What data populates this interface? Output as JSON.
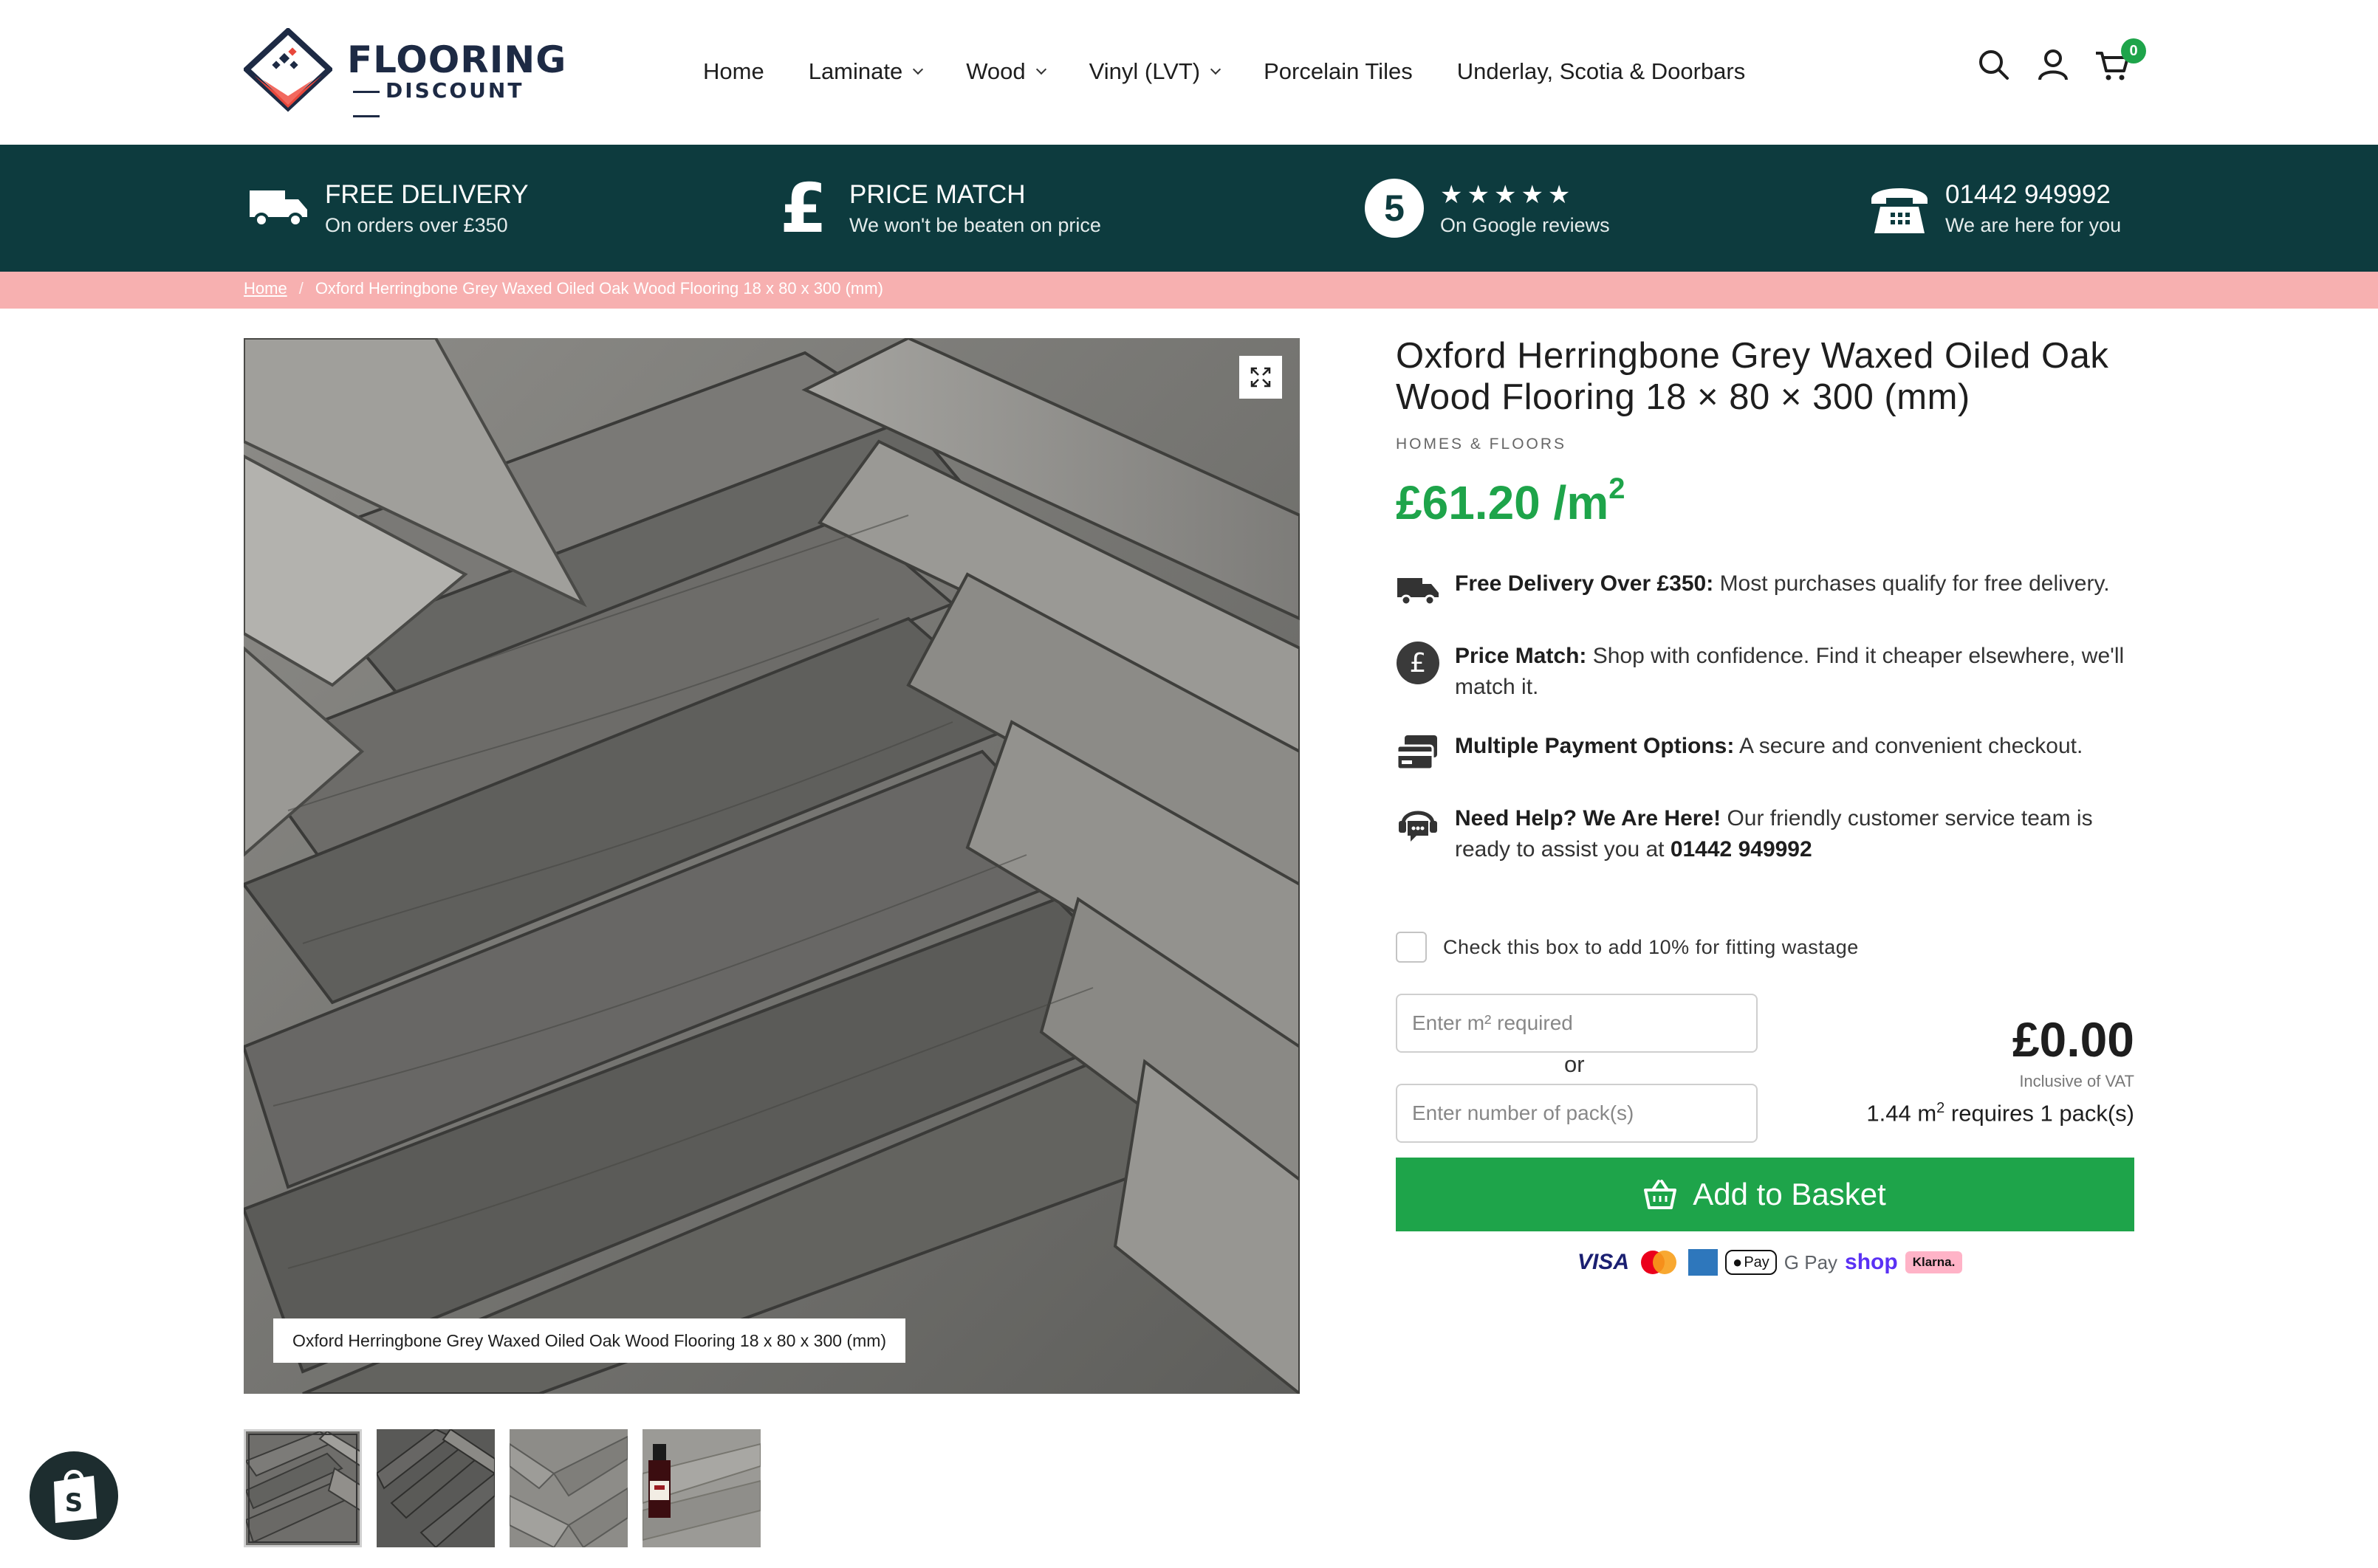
{
  "header": {
    "logo": {
      "line1": "FLOORING",
      "line2": "DISCOUNT"
    },
    "nav": [
      {
        "label": "Home",
        "dropdown": false
      },
      {
        "label": "Laminate",
        "dropdown": true
      },
      {
        "label": "Wood",
        "dropdown": true
      },
      {
        "label": "Vinyl (LVT)",
        "dropdown": true
      },
      {
        "label": "Porcelain Tiles",
        "dropdown": false
      },
      {
        "label": "Underlay, Scotia & Doorbars",
        "dropdown": false
      }
    ],
    "icons": [
      "search-icon",
      "account-icon",
      "cart-icon"
    ],
    "cart_count": "0"
  },
  "usp": {
    "delivery": {
      "title": "FREE DELIVERY",
      "sub": "On orders over £350"
    },
    "price_match": {
      "title": "PRICE MATCH",
      "sub": "We won't be beaten on price"
    },
    "reviews": {
      "rating": "5",
      "stars": "★★★★★",
      "sub": "On Google reviews"
    },
    "phone": {
      "title": "01442 949992",
      "sub": "We are here for you"
    }
  },
  "breadcrumb": {
    "home": "Home",
    "sep": "/",
    "current": "Oxford Herringbone Grey Waxed Oiled Oak Wood Flooring 18 x 80 x 300 (mm)"
  },
  "gallery": {
    "caption": "Oxford Herringbone Grey Waxed Oiled Oak Wood Flooring 18 x 80 x 300 (mm)",
    "thumb_count": 4
  },
  "product": {
    "title": "Oxford Herringbone Grey Waxed Oiled Oak Wood Flooring 18 × 80 × 300 (mm)",
    "vendor": "HOMES & FLOORS",
    "price": "£61.20 /m",
    "price_sup": "2"
  },
  "features": [
    {
      "icon": "truck-icon",
      "bold": "Free Delivery Over £350:",
      "text": " Most purchases qualify for free delivery."
    },
    {
      "icon": "pound-icon",
      "bold": "Price Match:",
      "text": " Shop with confidence. Find it cheaper elsewhere, we'll match it."
    },
    {
      "icon": "card-icon",
      "bold": "Multiple Payment Options:",
      "text": " A secure and convenient checkout."
    },
    {
      "icon": "support-icon",
      "bold": "Need Help? We Are Here!",
      "text": " Our friendly customer service team is ready to assist you at ",
      "phone": "01442 949992"
    }
  ],
  "calculator": {
    "wastage_label": "Check this box to add 10% for fitting wastage",
    "m2_placeholder": "Enter m² required",
    "or": "or",
    "packs_placeholder": "Enter number of pack(s)",
    "total": "£0.00",
    "vat": "Inclusive of VAT",
    "packs_text_1": "1.44 m",
    "packs_sup": "2",
    "packs_text_2": " requires 1 pack(s)"
  },
  "basket": {
    "label": "Add to Basket"
  },
  "payments": {
    "visa": "VISA",
    "apple": "Pay",
    "gpay": "G Pay",
    "shop": "shop",
    "klarna": "Klarna."
  },
  "colors": {
    "brand_dark": "#0d3b3e",
    "accent_green": "#1ea44a",
    "breadcrumb_pink": "#f7b0b0"
  }
}
